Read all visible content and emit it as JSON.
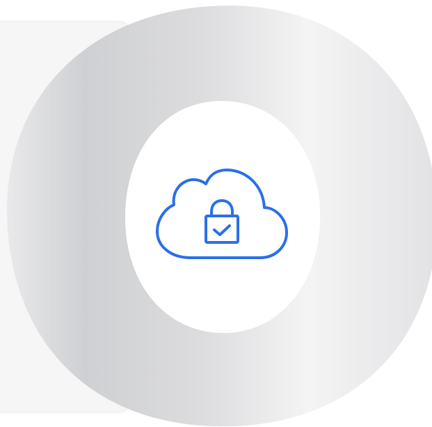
{
  "scene": {
    "icon": "cloud-lock-check-icon",
    "colors": {
      "accent": "#2a6fe8",
      "background": "#ffffff",
      "card": "#f6f6f7",
      "ring_dark": "#cfd0d3",
      "ring_light": "#f3f3f4"
    }
  }
}
